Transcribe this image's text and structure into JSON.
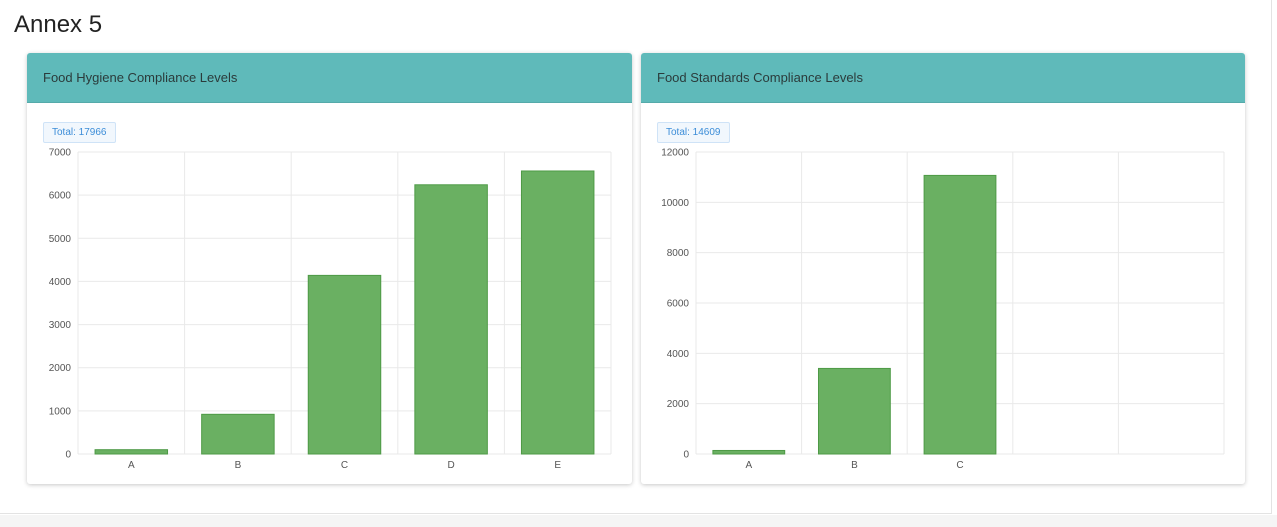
{
  "page": {
    "title": "Annex 5"
  },
  "panels": [
    {
      "title": "Food Hygiene Compliance Levels",
      "total_label": "Total: 17966"
    },
    {
      "title": "Food Standards Compliance Levels",
      "total_label": "Total: 14609"
    }
  ],
  "colors": {
    "bar_fill": "#6ab062",
    "bar_stroke": "#4e9a46",
    "header": "#5fbaba",
    "badge_text": "#3c8dd8"
  },
  "chart_data": [
    {
      "type": "bar",
      "title": "Food Hygiene Compliance Levels",
      "categories": [
        "A",
        "B",
        "C",
        "D",
        "E"
      ],
      "values": [
        100,
        920,
        4140,
        6240,
        6560
      ],
      "ylim": [
        0,
        7000
      ],
      "yticks": [
        0,
        1000,
        2000,
        3000,
        4000,
        5000,
        6000,
        7000
      ],
      "xlabel": "",
      "ylabel": "",
      "grid": true,
      "legend": "none"
    },
    {
      "type": "bar",
      "title": "Food Standards Compliance Levels",
      "categories": [
        "A",
        "B",
        "C",
        "",
        ""
      ],
      "values": [
        140,
        3400,
        11070,
        null,
        null
      ],
      "ylim": [
        0,
        12000
      ],
      "yticks": [
        0,
        2000,
        4000,
        6000,
        8000,
        10000,
        12000
      ],
      "xlabel": "",
      "ylabel": "",
      "grid": true,
      "legend": "none"
    }
  ]
}
